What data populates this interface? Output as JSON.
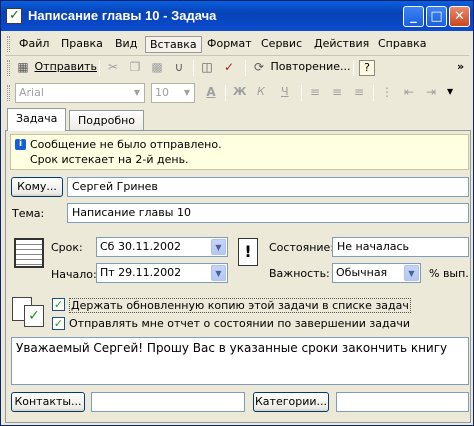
{
  "window": {
    "title": "Написание главы 10 - Задача",
    "min_label": "_",
    "max_label": "□",
    "close_label": "✕"
  },
  "menu": [
    {
      "label": "Файл"
    },
    {
      "label": "Правка"
    },
    {
      "label": "Вид"
    },
    {
      "label": "Вставка"
    },
    {
      "label": "Формат"
    },
    {
      "label": "Сервис"
    },
    {
      "label": "Действия"
    },
    {
      "label": "Справка"
    }
  ],
  "toolbar1": {
    "send_label": "Отправить",
    "recurrence_label": "Повторение...",
    "help_label": "?",
    "overflow_label": "»"
  },
  "toolbar2": {
    "font_name": "Arial",
    "font_size": "10",
    "bold": "Ж",
    "italic": "К",
    "underline": "Ч"
  },
  "tabs": [
    {
      "label": "Задача"
    },
    {
      "label": "Подробно"
    }
  ],
  "info": {
    "line1": "Сообщение не было отправлено.",
    "line2": "Срок истекает на 2-й день."
  },
  "to": {
    "button_label": "Кому...",
    "value": "Сергей Гринев"
  },
  "subject": {
    "label": "Тема:",
    "value": "Написание главы 10"
  },
  "dates": {
    "due_label": "Срок:",
    "due_value": "Сб 30.11.2002",
    "start_label": "Начало:",
    "start_value": "Пт 29.11.2002"
  },
  "status": {
    "label": "Состояние:",
    "value": "Не началась"
  },
  "priority": {
    "label": "Важность:",
    "value": "Обычная",
    "percent_label": "% вып."
  },
  "checks": [
    {
      "label": "Держать обновленную копию этой задачи в списке задач",
      "checked": true
    },
    {
      "label": "Отправлять мне отчет о состоянии по завершении задачи",
      "checked": true
    }
  ],
  "body_text": "Уважаемый Сергей! Прошу Вас в указанные сроки закончить книгу",
  "footer": {
    "contacts_label": "Контакты...",
    "categories_label": "Категории..."
  }
}
